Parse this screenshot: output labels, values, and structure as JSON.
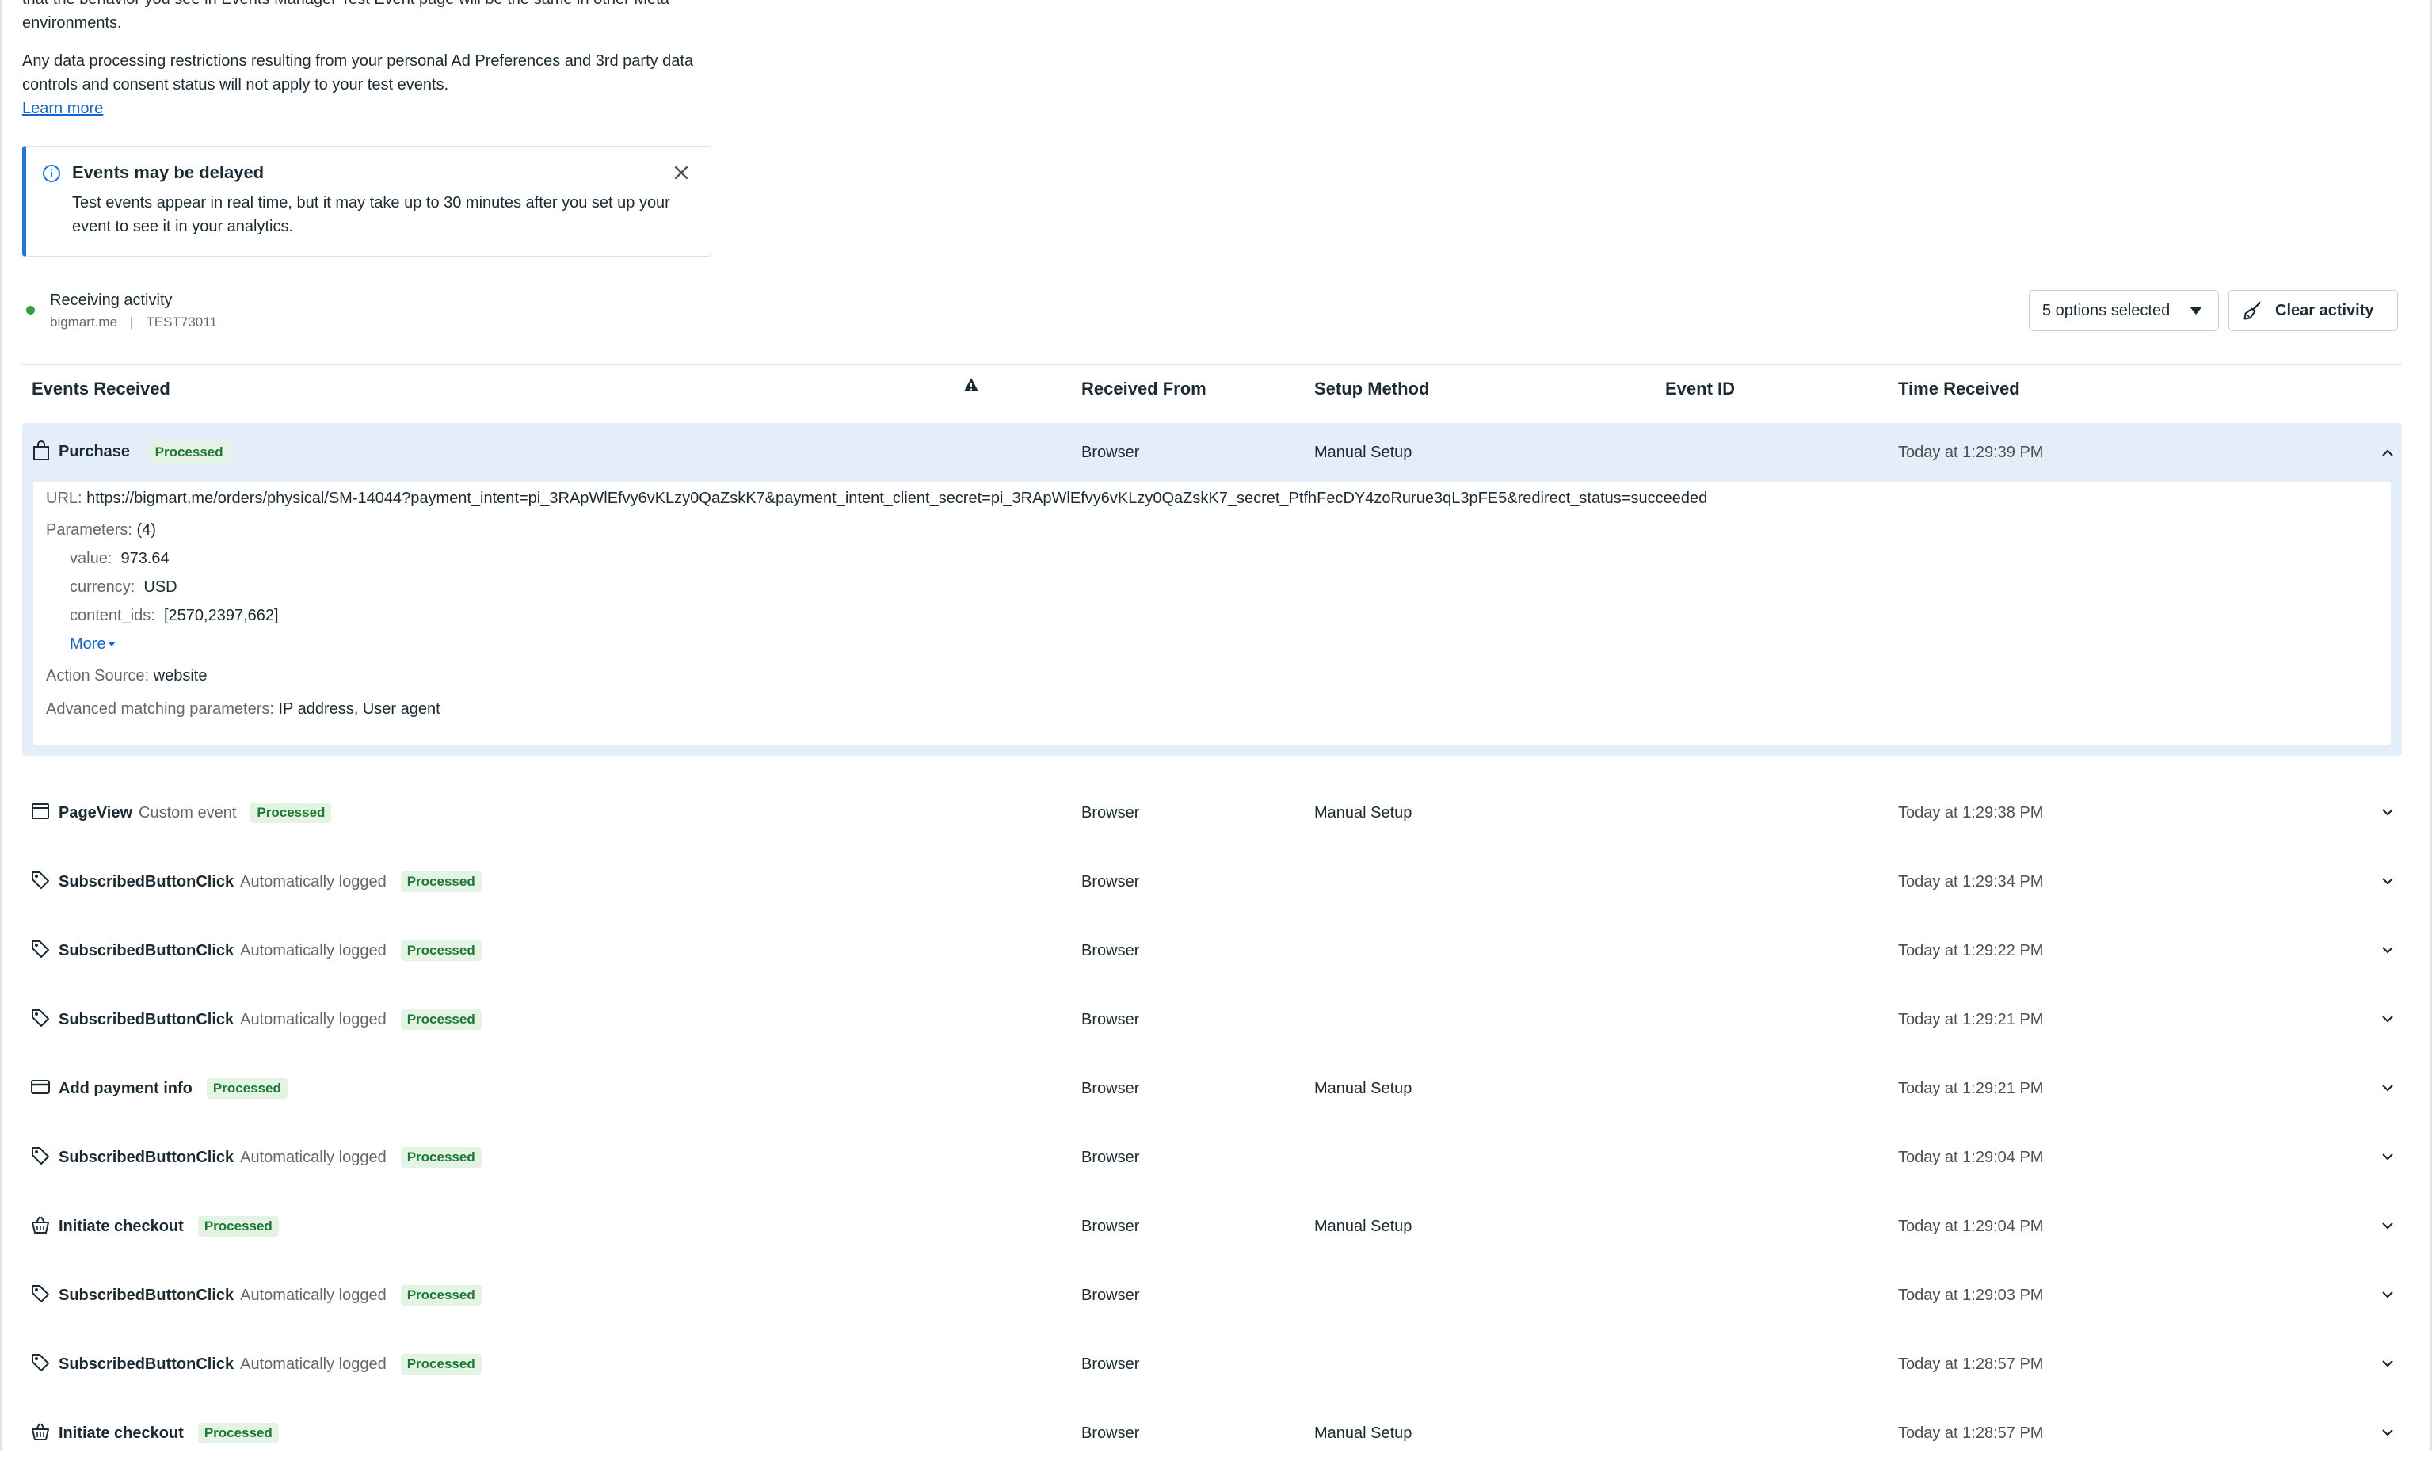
{
  "intro": {
    "partial_line_1": "that the behavior you see in Events Manager Test Event page will be the same in other Meta",
    "partial_line_2": "environments.",
    "paragraph": "Any data processing restrictions resulting from your personal Ad Preferences and 3rd party data controls and consent status will not apply to your test events.",
    "learn_more": "Learn more"
  },
  "notice": {
    "title": "Events may be delayed",
    "body": "Test events appear in real time, but it may take up to 30 minutes after you set up your event to see it in your analytics."
  },
  "status": {
    "title": "Receiving activity",
    "domain": "bigmart.me",
    "separator": "|",
    "code": "TEST73011",
    "dot_color": "#31a24c"
  },
  "toolbar": {
    "filter_label": "5 options selected",
    "clear_label": "Clear activity"
  },
  "table": {
    "headers": {
      "events": "Events Received",
      "from": "Received From",
      "setup": "Setup Method",
      "event_id": "Event ID",
      "time": "Time Received"
    },
    "expanded": {
      "icon": "shopping-bag-icon",
      "name": "Purchase",
      "status": "Processed",
      "from": "Browser",
      "setup": "Manual Setup",
      "time": "Today at 1:29:39 PM",
      "url_label": "URL:",
      "url": "https://bigmart.me/orders/physical/SM-14044?payment_intent=pi_3RApWlEfvy6vKLzy0QaZskK7&payment_intent_client_secret=pi_3RApWlEfvy6vKLzy0QaZskK7_secret_PtfhFecDY4zoRurue3qL3pFE5&redirect_status=succeeded",
      "params_label": "Parameters:",
      "params_count": "(4)",
      "params": [
        {
          "key": "value:",
          "val": "973.64"
        },
        {
          "key": "currency:",
          "val": "USD"
        },
        {
          "key": "content_ids:",
          "val": "[2570,2397,662]"
        }
      ],
      "more": "More",
      "action_source_label": "Action Source:",
      "action_source": "website",
      "adv_label": "Advanced matching parameters:",
      "adv": "IP address, User agent"
    },
    "rows": [
      {
        "icon": "browser-window-icon",
        "name": "PageView",
        "kind": "Custom event",
        "status": "Processed",
        "from": "Browser",
        "setup": "Manual Setup",
        "time": "Today at 1:29:38 PM"
      },
      {
        "icon": "tag-icon",
        "name": "SubscribedButtonClick",
        "kind": "Automatically logged",
        "status": "Processed",
        "from": "Browser",
        "setup": "",
        "time": "Today at 1:29:34 PM"
      },
      {
        "icon": "tag-icon",
        "name": "SubscribedButtonClick",
        "kind": "Automatically logged",
        "status": "Processed",
        "from": "Browser",
        "setup": "",
        "time": "Today at 1:29:22 PM"
      },
      {
        "icon": "tag-icon",
        "name": "SubscribedButtonClick",
        "kind": "Automatically logged",
        "status": "Processed",
        "from": "Browser",
        "setup": "",
        "time": "Today at 1:29:21 PM"
      },
      {
        "icon": "credit-card-icon",
        "name": "Add payment info",
        "kind": "",
        "status": "Processed",
        "from": "Browser",
        "setup": "Manual Setup",
        "time": "Today at 1:29:21 PM"
      },
      {
        "icon": "tag-icon",
        "name": "SubscribedButtonClick",
        "kind": "Automatically logged",
        "status": "Processed",
        "from": "Browser",
        "setup": "",
        "time": "Today at 1:29:04 PM"
      },
      {
        "icon": "basket-icon",
        "name": "Initiate checkout",
        "kind": "",
        "status": "Processed",
        "from": "Browser",
        "setup": "Manual Setup",
        "time": "Today at 1:29:04 PM"
      },
      {
        "icon": "tag-icon",
        "name": "SubscribedButtonClick",
        "kind": "Automatically logged",
        "status": "Processed",
        "from": "Browser",
        "setup": "",
        "time": "Today at 1:29:03 PM"
      },
      {
        "icon": "tag-icon",
        "name": "SubscribedButtonClick",
        "kind": "Automatically logged",
        "status": "Processed",
        "from": "Browser",
        "setup": "",
        "time": "Today at 1:28:57 PM"
      },
      {
        "icon": "basket-icon",
        "name": "Initiate checkout",
        "kind": "",
        "status": "Processed",
        "from": "Browser",
        "setup": "Manual Setup",
        "time": "Today at 1:28:57 PM"
      }
    ]
  },
  "colors": {
    "accent": "#1b74e4",
    "badge_bg": "#e3f4e5",
    "badge_text": "#1d7a33",
    "expanded_bg": "#e3eef8"
  }
}
